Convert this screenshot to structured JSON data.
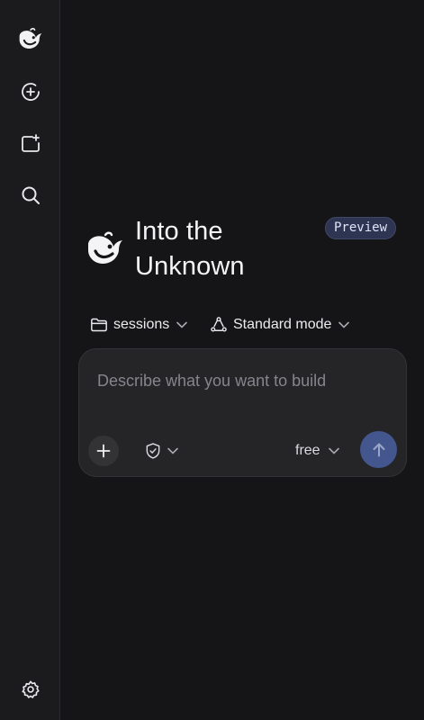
{
  "sidebar": {
    "items": [
      {
        "icon": "whale-logo-icon"
      },
      {
        "icon": "new-chat-icon"
      },
      {
        "icon": "new-project-icon"
      },
      {
        "icon": "search-icon"
      }
    ],
    "settings_icon": "gear-icon"
  },
  "hero": {
    "title_line1": "Into the",
    "title_line2": "Unknown",
    "badge": "Preview",
    "logo_icon": "whale-logo-icon"
  },
  "options": {
    "folder": {
      "label": "sessions",
      "icon": "folder-icon"
    },
    "mode": {
      "label": "Standard mode",
      "icon": "mode-cycle-icon"
    }
  },
  "composer": {
    "placeholder": "Describe what you want to build",
    "value": "",
    "model": "free",
    "add_icon": "plus-icon",
    "permission_icon": "shield-check-icon",
    "send_icon": "arrow-up-icon"
  },
  "colors": {
    "background": "#151518",
    "sidebar": "#1b1b1e",
    "composer": "#252528",
    "send_button": "#43568e",
    "badge_bg": "#2e3552"
  }
}
